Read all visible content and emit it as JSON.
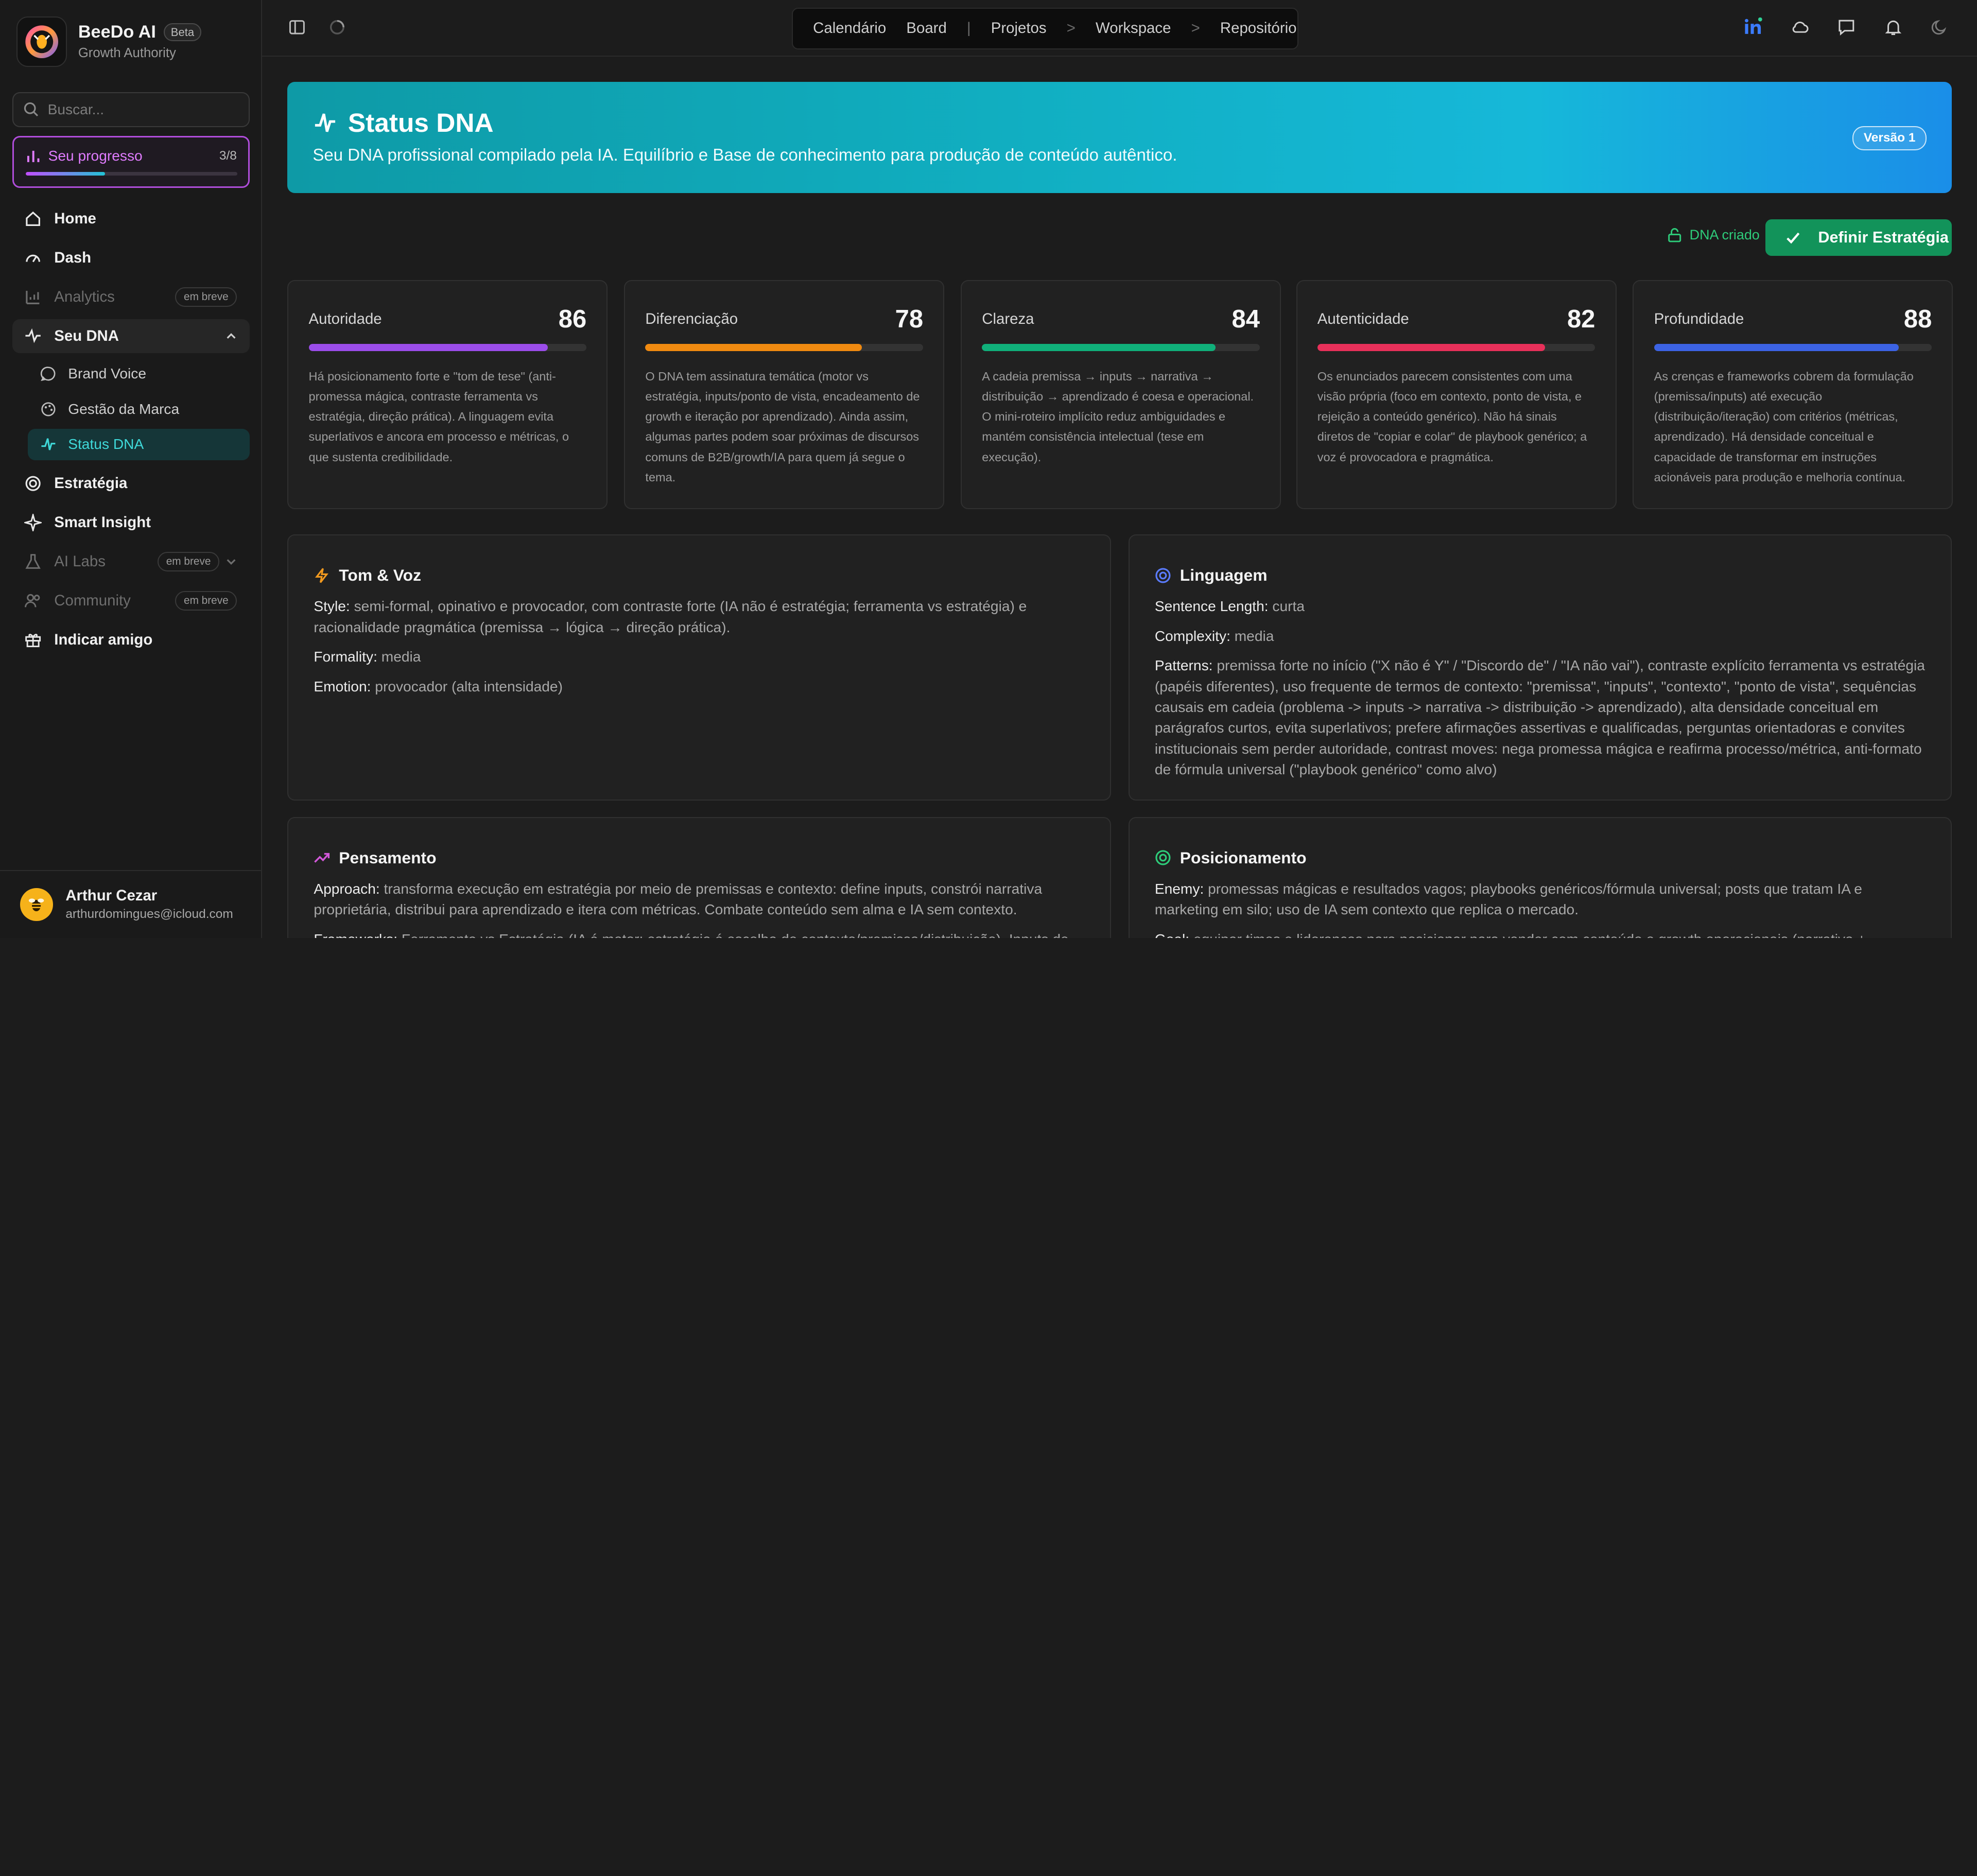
{
  "brand": {
    "name": "BeeDo AI",
    "badge": "Beta",
    "subtitle": "Growth Authority"
  },
  "search": {
    "placeholder": "Buscar..."
  },
  "progress": {
    "label": "Seu progresso",
    "count": "3/8",
    "fraction": 0.375
  },
  "nav": {
    "home": "Home",
    "dash": "Dash",
    "analytics": "Analytics",
    "analytics_badge": "em breve",
    "seu_dna": "Seu DNA",
    "brand_voice": "Brand Voice",
    "gestao": "Gestão da Marca",
    "status_dna": "Status DNA",
    "estrategia": "Estratégia",
    "smart_insight": "Smart Insight",
    "ai_labs": "AI Labs",
    "ai_labs_badge": "em breve",
    "community": "Community",
    "community_badge": "em breve",
    "indicar": "Indicar amigo"
  },
  "user": {
    "name": "Arthur Cezar",
    "email": "arthurdomingues@icloud.com"
  },
  "topnav": {
    "calendario": "Calendário",
    "board": "Board",
    "sep1": "|",
    "projetos": "Projetos",
    "sep2": ">",
    "workspace": "Workspace",
    "sep3": ">",
    "repositorio": "Repositório"
  },
  "banner": {
    "title": "Status DNA",
    "subtitle": "Seu DNA profissional compilado pela IA. Equilíbrio e Base de conhecimento para produção de conteúdo autêntico.",
    "version": "Versão 1"
  },
  "status": {
    "dna_created": "DNA criado",
    "define_strategy": "Definir Estratégia"
  },
  "scores": [
    {
      "name": "Autoridade",
      "value": 86,
      "color": "#9b4dea",
      "desc": "Há posicionamento forte e \"tom de tese\" (anti-promessa mágica, contraste ferramenta vs estratégia, direção prática). A linguagem evita superlativos e ancora em processo e métricas, o que sustenta credibilidade."
    },
    {
      "name": "Diferenciação",
      "value": 78,
      "color": "#f08a10",
      "desc": "O DNA tem assinatura temática (motor vs estratégia, inputs/ponto de vista, encadeamento de growth e iteração por aprendizado). Ainda assim, algumas partes podem soar próximas de discursos comuns de B2B/growth/IA para quem já segue o tema."
    },
    {
      "name": "Clareza",
      "value": 84,
      "color": "#10b07a",
      "desc": "A cadeia premissa → inputs → narrativa → distribuição → aprendizado é coesa e operacional. O mini-roteiro implícito reduz ambiguidades e mantém consistência intelectual (tese em execução)."
    },
    {
      "name": "Autenticidade",
      "value": 82,
      "color": "#e8305a",
      "desc": "Os enunciados parecem consistentes com uma visão própria (foco em contexto, ponto de vista, e rejeição a conteúdo genérico). Não há sinais diretos de \"copiar e colar\" de playbook genérico; a voz é provocadora e pragmática."
    },
    {
      "name": "Profundidade",
      "value": 88,
      "color": "#3c63e4",
      "desc": "As crenças e frameworks cobrem da formulação (premissa/inputs) até execução (distribuição/iteração) com critérios (métricas, aprendizado). Há densidade conceitual e capacidade de transformar em instruções acionáveis para produção e melhoria contínua."
    }
  ],
  "tom": {
    "title": "Tom & Voz",
    "style_k": "Style:",
    "style_v": "semi-formal, opinativo e provocador, com contraste forte (IA não é estratégia; ferramenta vs estratégia) e racionalidade pragmática (premissa → lógica → direção prática).",
    "formality_k": "Formality:",
    "formality_v": "media",
    "emotion_k": "Emotion:",
    "emotion_v": "provocador (alta intensidade)"
  },
  "linguagem": {
    "title": "Linguagem",
    "sentence_k": "Sentence Length:",
    "sentence_v": "curta",
    "complexity_k": "Complexity:",
    "complexity_v": "media",
    "patterns_k": "Patterns:",
    "patterns_v": "premissa forte no início (\"X não é Y\" / \"Discordo de\" / \"IA não vai\"), contraste explícito ferramenta vs estratégia (papéis diferentes), uso frequente de termos de contexto: \"premissa\", \"inputs\", \"contexto\", \"ponto de vista\", sequências causais em cadeia (problema -> inputs -> narrativa -> distribuição -> aprendizado), alta densidade conceitual em parágrafos curtos, evita superlativos; prefere afirmações assertivas e qualificadas, perguntas orientadoras e convites institucionais sem perder autoridade, contrast moves: nega promessa mágica e reafirma processo/métrica, anti-formato de fórmula universal (\"playbook genérico\" como alvo)"
  },
  "pensamento": {
    "title": "Pensamento",
    "approach_k": "Approach:",
    "approach_v": "transforma execução em estratégia por meio de premissas e contexto: define inputs, constrói narrativa proprietária, distribui para aprendizado e itera com métricas. Combate conteúdo sem alma e IA sem contexto.",
    "frameworks_k": "Frameworks:",
    "frameworks_v": "Ferramenta vs Estratégia (IA é motor; estratégia é escolha de contexto/premissa/distribuição). Inputs de IA..."
  },
  "posicionamento": {
    "title": "Posicionamento",
    "enemy_k": "Enemy:",
    "enemy_v": "promessas mágicas e resultados vagos; playbooks genéricos/fórmula universal; posts que tratam IA e marketing em silo; uso de IA sem contexto que replica o mercado.",
    "goal_k": "Goal:",
    "goal_v": "equipar times e lideranças para posicionar para vender com conteúdo e growth operacionais (narrativa + ..."
  }
}
